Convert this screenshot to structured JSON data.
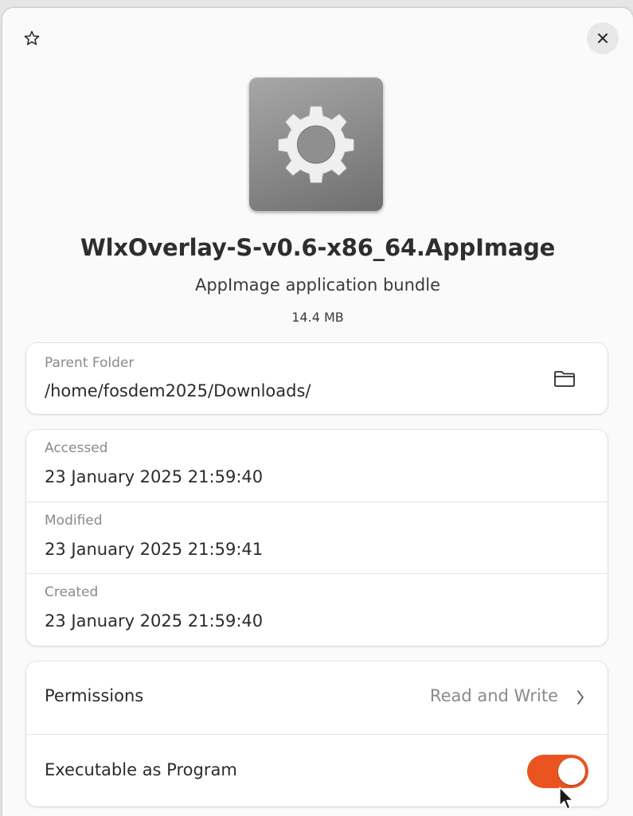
{
  "header": {
    "star_icon": "star-outline-icon",
    "close_icon": "close-icon"
  },
  "file": {
    "icon": "gear-icon",
    "name": "WlxOverlay-S-v0.6-x86_64.AppImage",
    "type": "AppImage application bundle",
    "size": "14.4 MB"
  },
  "parent_folder": {
    "caption": "Parent Folder",
    "path": "/home/fosdem2025/Downloads/",
    "open_icon": "folder-icon"
  },
  "dates": {
    "accessed_caption": "Accessed",
    "accessed_value": "23 January 2025 21:59:40",
    "modified_caption": "Modified",
    "modified_value": "23 January 2025 21:59:41",
    "created_caption": "Created",
    "created_value": "23 January 2025 21:59:40"
  },
  "permissions": {
    "label": "Permissions",
    "value": "Read and Write",
    "chevron_icon": "chevron-right-icon",
    "executable_label": "Executable as Program",
    "executable_enabled": true
  },
  "colors": {
    "accent": "#e95420",
    "background": "#fafafa",
    "card": "#ffffff",
    "text": "#2b2b2b",
    "muted": "#8a8a8a"
  }
}
